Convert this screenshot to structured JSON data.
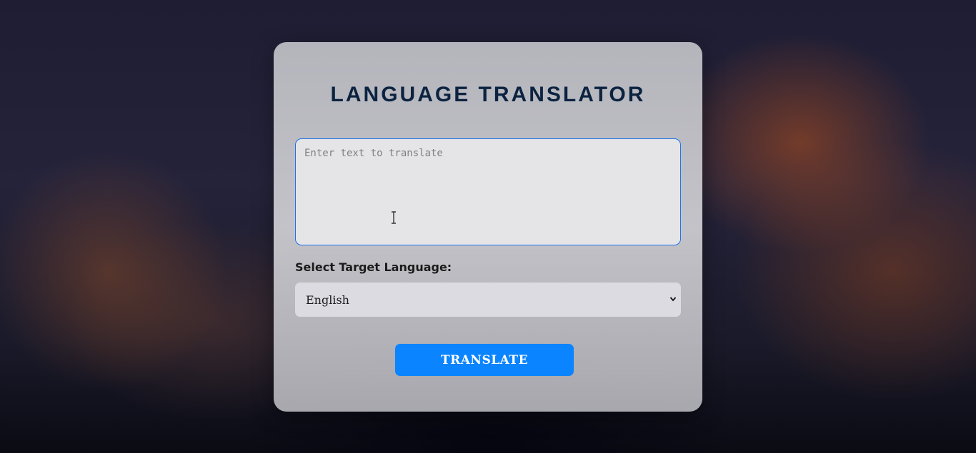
{
  "app": {
    "title": "LANGUAGE TRANSLATOR"
  },
  "input": {
    "value": "",
    "placeholder": "Enter text to translate"
  },
  "target_language": {
    "label": "Select Target Language:",
    "selected": "English"
  },
  "actions": {
    "translate_label": "TRANSLATE"
  },
  "colors": {
    "accent": "#0a84ff",
    "title": "#0c2340",
    "focus_border": "#1a73e8"
  },
  "icons": {
    "text_cursor": "text-cursor-icon",
    "dropdown": "chevron-down-icon"
  }
}
